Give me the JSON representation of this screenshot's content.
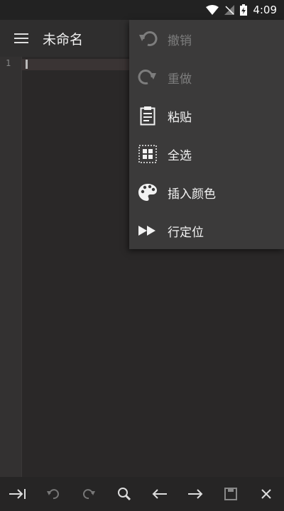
{
  "status": {
    "time": "4:09"
  },
  "appbar": {
    "title": "未命名"
  },
  "editor": {
    "line_numbers": [
      "1"
    ]
  },
  "menu": {
    "items": [
      {
        "label": "撤销",
        "icon": "undo-icon",
        "enabled": false
      },
      {
        "label": "重做",
        "icon": "redo-icon",
        "enabled": false
      },
      {
        "label": "粘贴",
        "icon": "clipboard-icon",
        "enabled": true
      },
      {
        "label": "全选",
        "icon": "select-all-icon",
        "enabled": true
      },
      {
        "label": "插入颜色",
        "icon": "palette-icon",
        "enabled": true
      },
      {
        "label": "行定位",
        "icon": "fast-forward-icon",
        "enabled": true
      }
    ]
  },
  "toolbar": {
    "icons": [
      "tab-icon",
      "undo-icon",
      "redo-icon",
      "search-icon",
      "arrow-left-icon",
      "arrow-right-icon",
      "save-icon",
      "close-icon"
    ]
  },
  "colors": {
    "background": "#2a2828",
    "menu": "#3b3a3a",
    "disabled_text": "#7d7d7d"
  }
}
